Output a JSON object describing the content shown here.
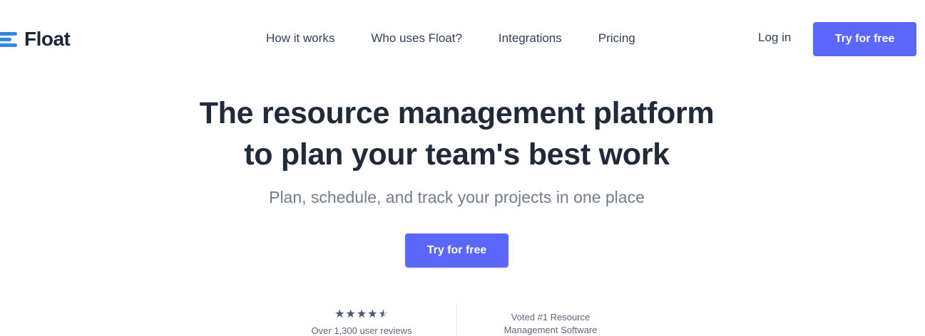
{
  "header": {
    "logo_text": "Float",
    "nav": [
      {
        "label": "How it works"
      },
      {
        "label": "Who uses Float?"
      },
      {
        "label": "Integrations"
      },
      {
        "label": "Pricing"
      }
    ],
    "login_label": "Log in",
    "cta_label": "Try for free"
  },
  "hero": {
    "title_line1": "The resource management platform",
    "title_line2": "to plan your team's best work",
    "subtitle": "Plan, schedule, and track your projects in one place",
    "cta_label": "Try for free"
  },
  "proof": {
    "rating_stars": 4.5,
    "reviews_text": "Over 1,300 user reviews",
    "voted_line1": "Voted #1 Resource",
    "voted_line2": "Management Software"
  },
  "colors": {
    "brand_blue": "#2e86f0",
    "cta": "#5b67fb",
    "heading": "#222a38"
  },
  "icons": {
    "logo": "float-logo-icon",
    "star": "star-icon"
  }
}
